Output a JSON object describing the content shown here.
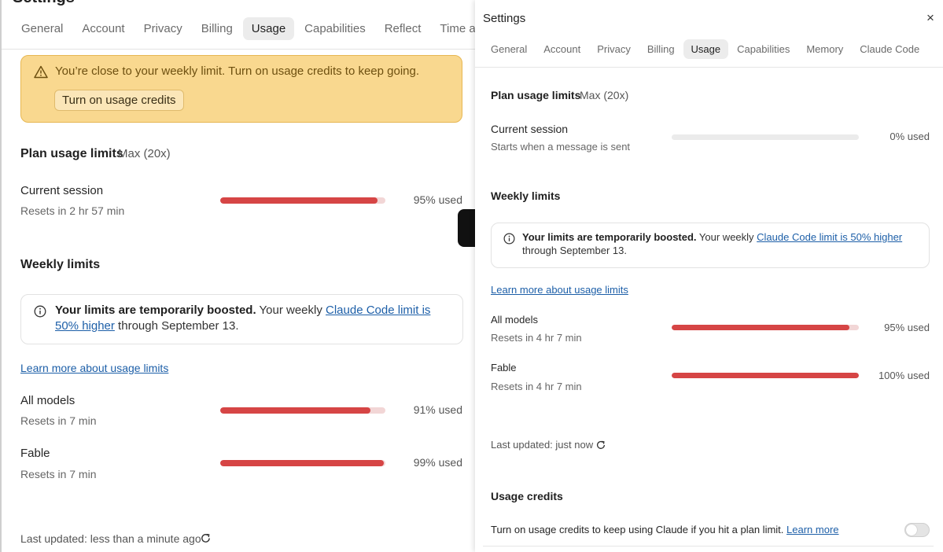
{
  "bg": {
    "title": "Settings",
    "tabs": [
      "General",
      "Account",
      "Privacy",
      "Billing",
      "Usage",
      "Capabilities",
      "Reflect",
      "Time a"
    ],
    "active_tab": "Usage",
    "warning": {
      "message": "You’re close to your weekly limit. Turn on usage credits to keep going.",
      "button": "Turn on usage credits"
    },
    "plan": {
      "heading": "Plan usage limits",
      "tier": "Max (20x)"
    },
    "current_session": {
      "label": "Current session",
      "reset": "Resets in 2 hr 57 min",
      "percent": 95,
      "percent_label": "95% used"
    },
    "weekly": {
      "heading": "Weekly limits",
      "boost_bold": "Your limits are temporarily boosted.",
      "boost_pre": " Your weekly ",
      "boost_link": "Claude Code limit is 50% higher",
      "boost_post": " through September 13.",
      "learn_more": "Learn more about usage limits",
      "rows": [
        {
          "label": "All models",
          "reset": "Resets in 7 min",
          "percent": 91,
          "percent_label": "91% used"
        },
        {
          "label": "Fable",
          "reset": "Resets in 7 min",
          "percent": 99,
          "percent_label": "99% used"
        }
      ]
    },
    "last_updated": "Last updated: less than a minute ago"
  },
  "modal": {
    "title": "Settings",
    "close": "×",
    "tabs": [
      "General",
      "Account",
      "Privacy",
      "Billing",
      "Usage",
      "Capabilities",
      "Memory",
      "Claude Code"
    ],
    "active_tab": "Usage",
    "plan": {
      "heading": "Plan usage limits",
      "tier": "Max (20x)"
    },
    "current_session": {
      "label": "Current session",
      "reset": "Starts when a message is sent",
      "percent": 0,
      "percent_label": "0% used"
    },
    "weekly": {
      "heading": "Weekly limits",
      "boost_bold": "Your limits are temporarily boosted.",
      "boost_pre": " Your weekly ",
      "boost_link": "Claude Code limit is 50% higher",
      "boost_post": "through September 13.",
      "learn_more": "Learn more about usage limits",
      "rows": [
        {
          "label": "All models",
          "reset": "Resets in 4 hr 7 min",
          "percent": 95,
          "percent_label": "95% used"
        },
        {
          "label": "Fable",
          "reset": "Resets in 4 hr 7 min",
          "percent": 100,
          "percent_label": "100% used"
        }
      ]
    },
    "last_updated": "Last updated: just now",
    "credits": {
      "heading": "Usage credits",
      "text": "Turn on usage credits to keep using Claude if you hit a plan limit.",
      "link": "Learn more",
      "toggle_on": false
    }
  },
  "colors": {
    "bar_fill": "#d64545",
    "bar_track": "#f2d6d6",
    "warning_bg": "#f9d88f",
    "link": "#1d5fa8"
  },
  "icons": [
    "warning-icon",
    "info-icon",
    "refresh-icon",
    "close-icon"
  ]
}
